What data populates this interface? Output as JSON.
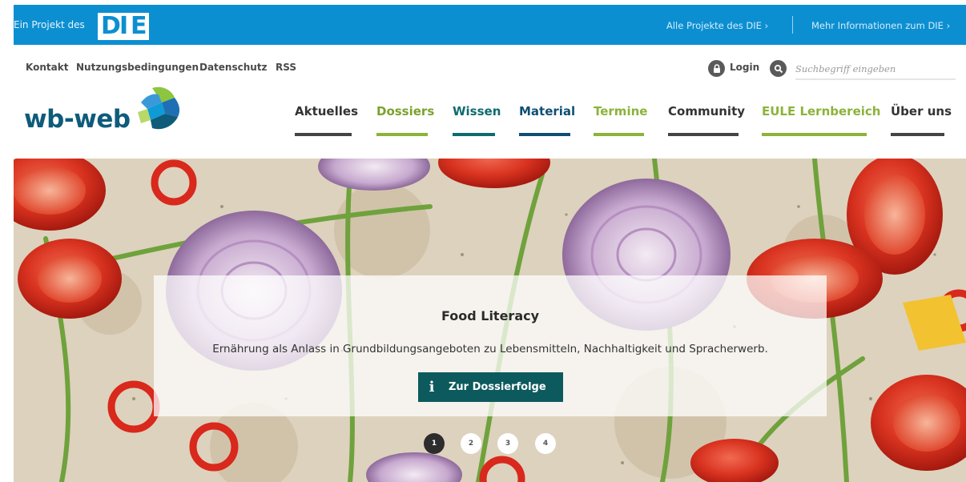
{
  "topbar": {
    "project_label": "Ein Projekt des",
    "die_logo_text": "DIE",
    "all_projects_link": "Alle Projekte des DIE ›",
    "more_info_link": "Mehr Informationen zum DIE ›",
    "background_color": "#0c8fd1"
  },
  "utility_nav": {
    "links": [
      "Kontakt",
      "Nutzungsbedingungen",
      "Datenschutz",
      "RSS"
    ],
    "login_label": "Login",
    "search_placeholder": "Suchbegriff eingeben"
  },
  "brand": {
    "name": "wb-web",
    "color": "#0e5b7a"
  },
  "main_nav": {
    "items": [
      {
        "label": "Aktuelles",
        "color": "#333333",
        "bar_color": "#444444"
      },
      {
        "label": "Dossiers",
        "color": "#7aa22d",
        "bar_color": "#8cb33a"
      },
      {
        "label": "Wissen",
        "color": "#0f6b6e",
        "bar_color": "#0f6b6e"
      },
      {
        "label": "Material",
        "color": "#0f4f74",
        "bar_color": "#0f4f74"
      },
      {
        "label": "Termine",
        "color": "#8cb33a",
        "bar_color": "#8cb33a"
      },
      {
        "label": "Community",
        "color": "#333333",
        "bar_color": "#444444"
      },
      {
        "label": "EULE Lernbereich",
        "color": "#8cb33a",
        "bar_color": "#8cb33a"
      },
      {
        "label": "Über uns",
        "color": "#333333",
        "bar_color": "#444444"
      }
    ]
  },
  "hero": {
    "title": "Food Literacy",
    "text": "Ernährung als Anlass in Grundbildungsangeboten zu Lebensmitteln, Nachhaltigkeit und Spracherwerb.",
    "button_icon": "i",
    "button_label": "Zur Dossierfolge",
    "button_color": "#0d5a5e",
    "slides": [
      "1",
      "2",
      "3",
      "4"
    ],
    "active_slide": 1
  }
}
